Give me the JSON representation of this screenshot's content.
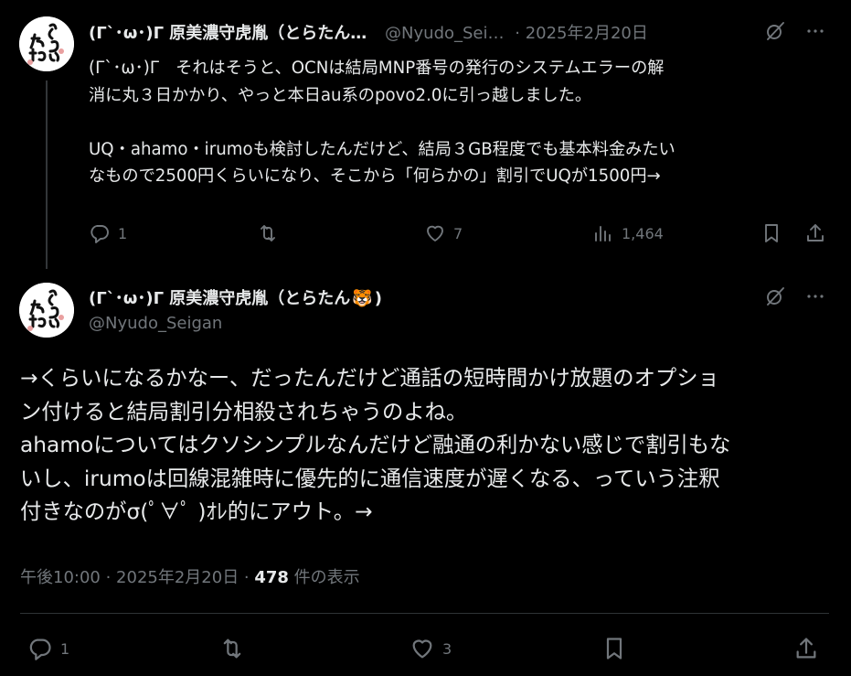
{
  "tweet1": {
    "display_name": "(Γ`･ω･)Γ 原美濃守虎胤（とらたん…",
    "handle": "@Nyudo_Sei…",
    "date": "· 2025年2月20日",
    "text_lines": [
      "(Γ`･ω･)Γ　それはそうと、OCNは結局MNP番号の発行のシステムエラーの解",
      "消に丸３日かかり、やっと本日au系のpovo2.0に引っ越しました。",
      "",
      "UQ・ahamo・irumoも検討したんだけど、結局３GB程度でも基本料金みたい",
      "なもので2500円くらいになり、そこから「何らかの」割引でUQが1500円→"
    ],
    "replies": "1",
    "likes": "7",
    "views": "1,464"
  },
  "tweet2": {
    "display_name": "(Γ`･ω･)Γ 原美濃守虎胤（とらたん",
    "name_suffix": ")",
    "tiger_emoji": "🐯",
    "handle": "@Nyudo_Seigan",
    "text_lines": [
      "→くらいになるかなー、だったんだけど通話の短時間かけ放題のオプショ",
      "ン付けると結局割引分相殺されちゃうのよね。",
      "ahamoについてはクソシンプルなんだけど融通の利かない感じで割引もな",
      "いし、irumoは回線混雑時に優先的に通信速度が遅くなる、っていう注釈",
      "付きなのがσ(ﾟ∀ﾟ )ｵﾚ的にアウト。→"
    ],
    "time_date": "午後10:00 · 2025年2月20日 · ",
    "views_count": "478",
    "views_label": " 件の表示",
    "replies": "1",
    "likes": "3"
  },
  "avatar_text": "とらたん",
  "colors": {
    "background": "#000000",
    "text": "#e7e9ea",
    "muted": "#71767b",
    "divider": "#2f3336"
  }
}
